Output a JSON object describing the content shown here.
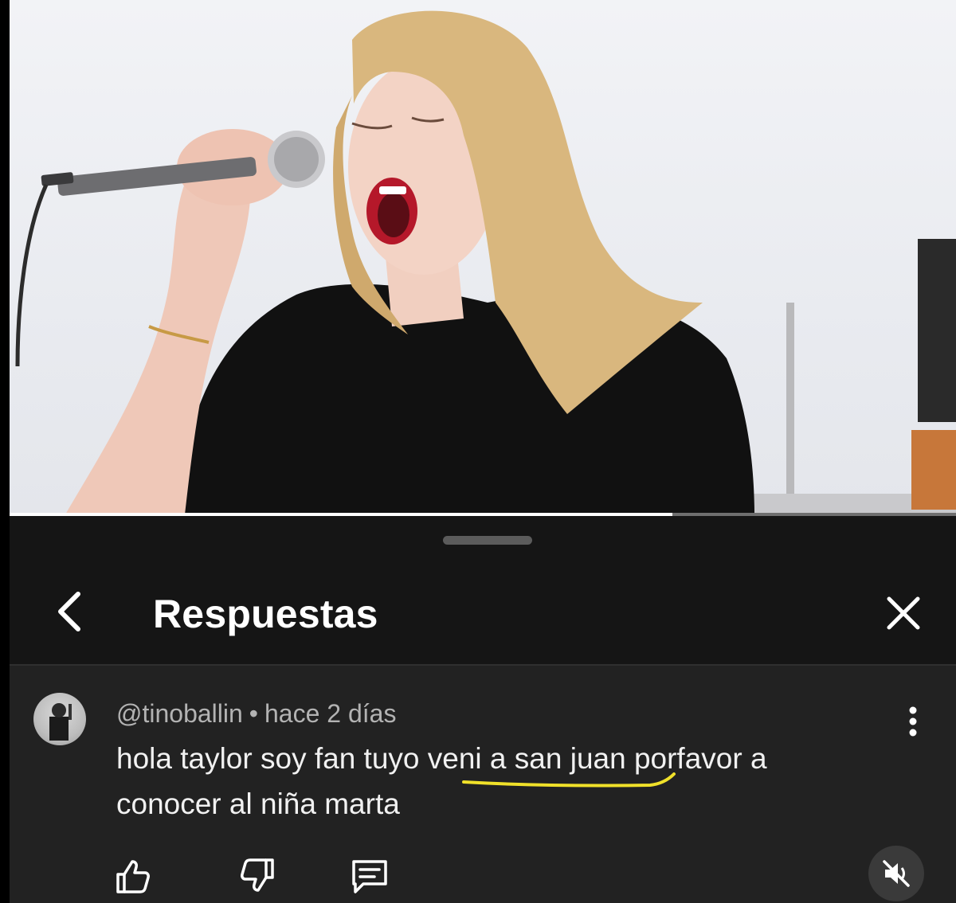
{
  "video": {
    "progress_fraction": 0.7,
    "background_color": "#eceef2"
  },
  "sheet": {
    "title": "Respuestas",
    "back_icon": "chevron-left-icon",
    "close_icon": "close-icon"
  },
  "comment": {
    "author": "@tinoballin",
    "separator": "•",
    "time": "hace 2 días",
    "text_line1": "hola taylor soy fan tuyo veni a san juan porfavor a",
    "text_line2": "conocer al niña marta",
    "highlight_color": "#f0e12a",
    "more_icon": "more-vertical-icon"
  },
  "actions": {
    "like_icon": "thumbs-up-icon",
    "dislike_icon": "thumbs-down-icon",
    "reply_icon": "reply-comment-icon",
    "mute_icon": "volume-muted-icon"
  }
}
